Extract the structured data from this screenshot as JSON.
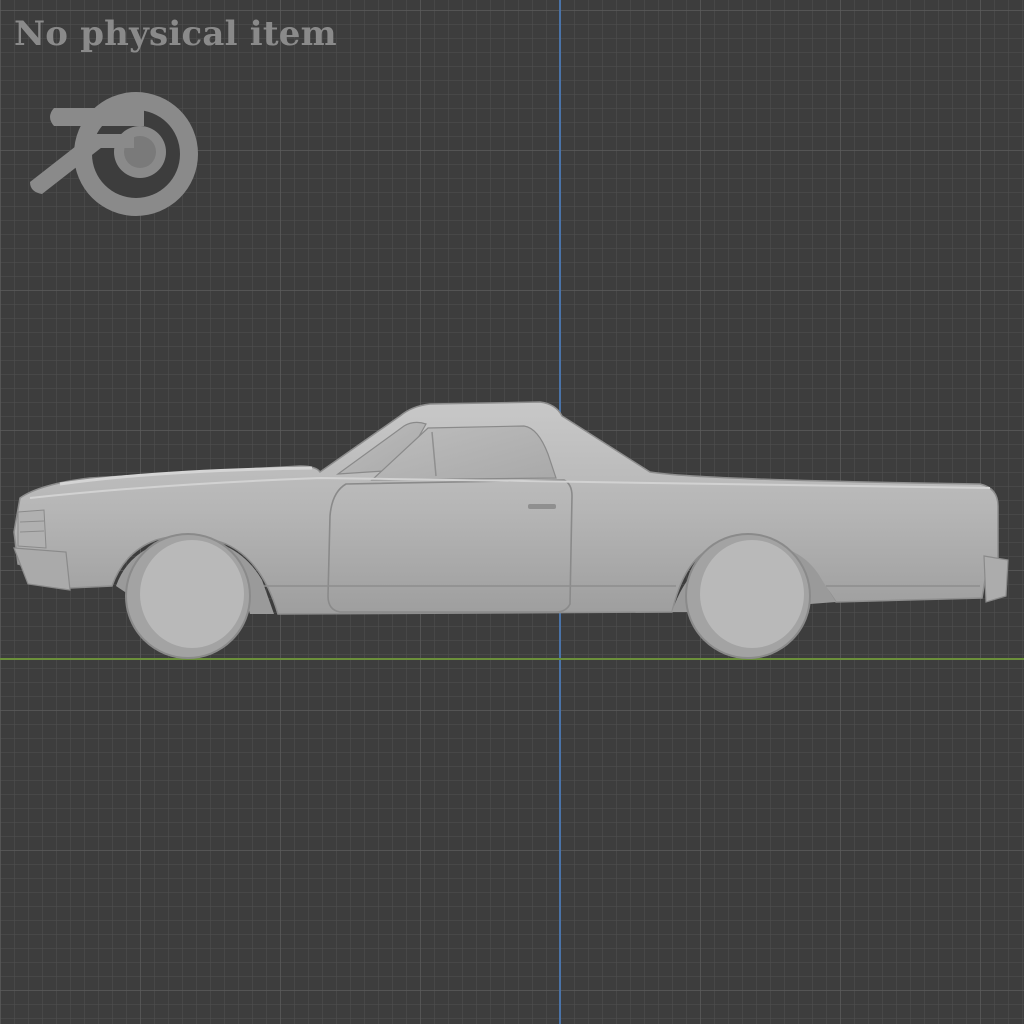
{
  "watermark": {
    "text": "No physical item"
  },
  "scene": {
    "view": "orthographic side view",
    "object": "pickup coupe car model",
    "logo_icon": "blender-logo-icon"
  },
  "colors": {
    "background": "#3d3d3d",
    "axis_x": "#6b8f3a",
    "axis_y": "#4a73a8",
    "model": "#b3b3b3",
    "watermark": "#8a8a8a"
  }
}
